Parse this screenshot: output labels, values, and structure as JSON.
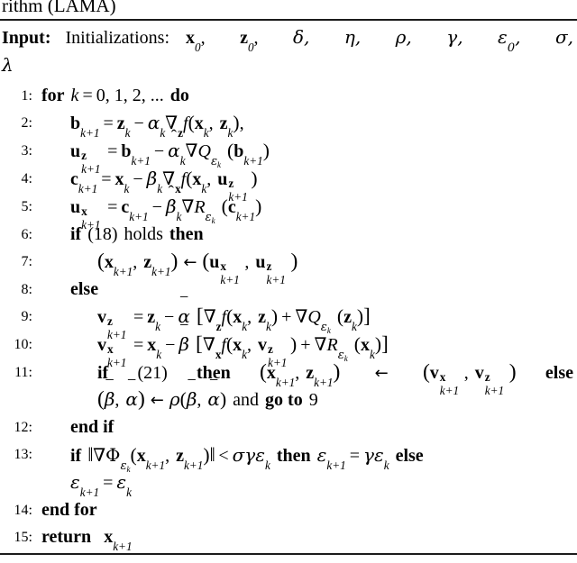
{
  "document": {
    "type": "algorithm-block",
    "title_fragment": "rithm (LAMA)",
    "rule_color": "#1b1b1b"
  },
  "input": {
    "label": "Input:",
    "word": "Initializations:",
    "params": [
      "x",
      "z",
      "δ",
      "η",
      "ρ",
      "γ",
      "ε",
      "σ"
    ],
    "params_text": "x₀,  z₀,  δ,  η,  ρ,  γ,  ε₀,  σ,",
    "wrap_param": "λ"
  },
  "keywords": {
    "for": "for",
    "do": "do",
    "if": "if",
    "then": "then",
    "else": "else",
    "end_if": "end if",
    "end_for": "end for",
    "return": "return",
    "holds": "holds",
    "and": "and",
    "go_to": "go to"
  },
  "lines": [
    {
      "n": "1:",
      "text": "for k = 0, 1, 2, ... do"
    },
    {
      "n": "2:",
      "text": "b_{k+1} = z_k − α_k ∇_z f(x_k, z_k),"
    },
    {
      "n": "3:",
      "text": "u^z_{k+1} = b_{k+1} − α̂_k ∇Q_{ε_k}(b_{k+1})"
    },
    {
      "n": "4:",
      "text": "c_{k+1} = x_k − β_k ∇_x f(x_k, u^z_{k+1})"
    },
    {
      "n": "5:",
      "text": "u^x_{k+1} = c_{k+1} − β̂_k ∇R_{ε_k}(c_{k+1})"
    },
    {
      "n": "6:",
      "text": "if (18) holds then"
    },
    {
      "n": "7:",
      "text": "(x_{k+1}, z_{k+1}) ← (u^x_{k+1}, u^z_{k+1})"
    },
    {
      "n": "8:",
      "text": "else"
    },
    {
      "n": "9:",
      "text": "v^z_{k+1} = z_k − ᾱ [∇_z f(x_k, z_k) + ∇Q_{ε_k}(z_k)]"
    },
    {
      "n": "10:",
      "text": "v^x_{k+1} = x_k − β̄ [∇_x f(x_k, v^z_{k+1}) + ∇R_{ε_k}(x_k)]"
    },
    {
      "n": "11:",
      "text": "if (21) then (x_{k+1}, z_{k+1}) ← (v^x_{k+1}, v^z_{k+1}) else (β̄, ᾱ) ← ρ(β̄, ᾱ) and go to 9"
    },
    {
      "n": "12:",
      "text": "end if"
    },
    {
      "n": "13:",
      "text": "if ‖∇Φ_{ε_k}(x_{k+1}, z_{k+1})‖ < σγε_k then ε_{k+1} = γε_k else ε_{k+1} = ε_k"
    },
    {
      "n": "14:",
      "text": "end for"
    },
    {
      "n": "15:",
      "text": "return x_{k+1}"
    }
  ],
  "labels": {
    "cond_18": "(18)",
    "cond_21": "(21)",
    "goto_target": "9",
    "loop_start": "0, 1, 2, ..."
  }
}
